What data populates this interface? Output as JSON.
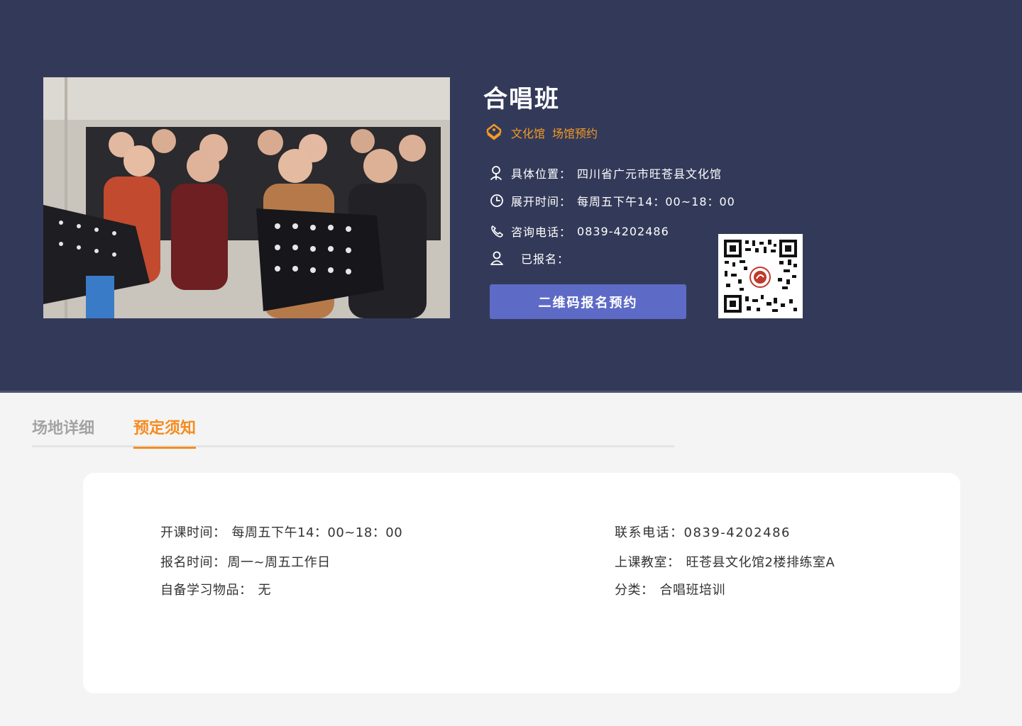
{
  "course": {
    "title": "合唱班",
    "tags": [
      "文化馆",
      "场馆预约"
    ],
    "location_label": "具体位置：",
    "location_value": "四川省广元市旺苍县文化馆",
    "time_label": "展开时间：",
    "time_value": "每周五下午14：00~18：00",
    "phone_label": "咨询电话：",
    "phone_value": "0839-4202486",
    "registered_label": "已报名："
  },
  "register_button": "二维码报名预约",
  "tabs": [
    {
      "label": "场地详细",
      "active": false
    },
    {
      "label": "预定须知",
      "active": true
    }
  ],
  "notice": {
    "class_time_label": "开课时间：",
    "class_time_value": "每周五下午14：00~18：00",
    "signup_time_label": "报名时间：",
    "signup_time_value": "周一~周五工作日",
    "supplies_label": "自备学习物品：",
    "supplies_value": "无",
    "contact_label": "联系电话：",
    "contact_value": "0839-4202486",
    "classroom_label": "上课教室：",
    "classroom_value": "旺苍县文化馆2楼排练室A",
    "category_label": "分类：",
    "category_value": "合唱班培训"
  },
  "colors": {
    "hero_bg": "#333a59",
    "accent_orange": "#f58b1f",
    "button_blue": "#5e6bc6",
    "page_bg": "#f4f4f4"
  },
  "icons": [
    "tag-icon",
    "location-icon",
    "clock-icon",
    "phone-icon",
    "user-icon",
    "qr-code"
  ]
}
